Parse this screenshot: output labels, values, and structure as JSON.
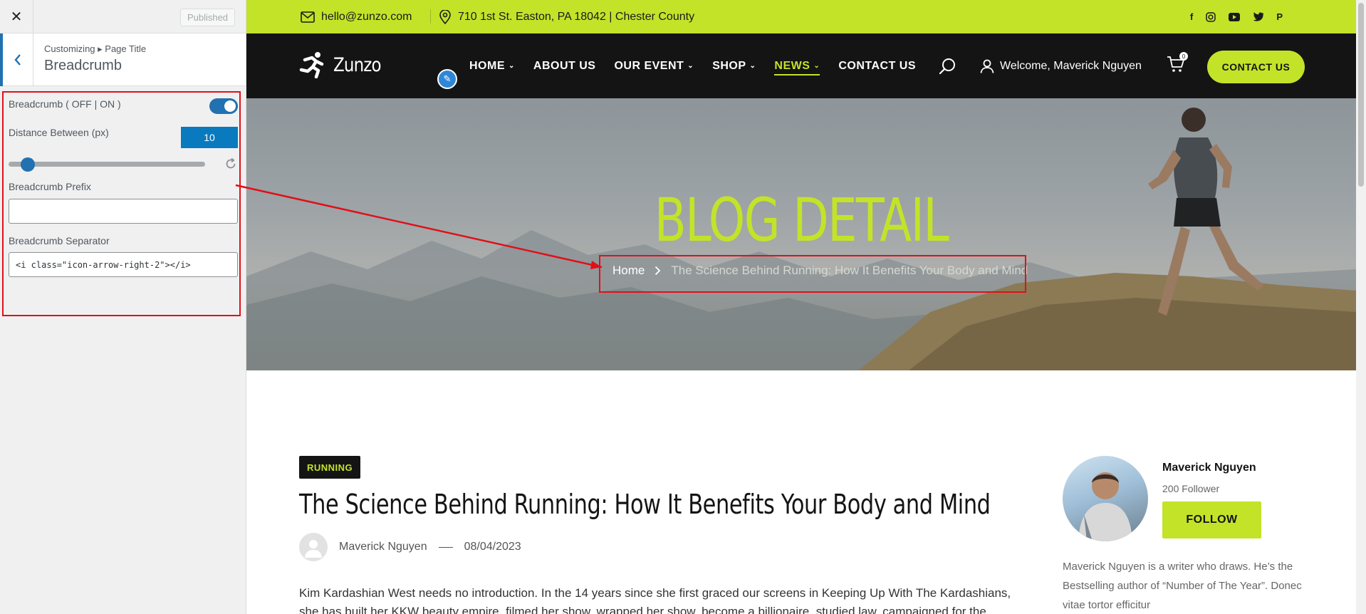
{
  "customizer": {
    "close_label": "✕",
    "publish_label": "Published",
    "breadcrumb_path": "Customizing ▸ Page Title",
    "section_title": "Breadcrumb",
    "toggle_label": "Breadcrumb ( OFF | ON )",
    "toggle_on": true,
    "distance_label": "Distance Between (px)",
    "distance_value": "10",
    "prefix_label": "Breadcrumb Prefix",
    "prefix_value": "",
    "separator_label": "Breadcrumb Separator",
    "separator_value": "<i class=\"icon-arrow-right-2\"></i>"
  },
  "topbar": {
    "email": "hello@zunzo.com",
    "address": "710 1st St. Easton, PA 18042 | Chester County",
    "socials": [
      "facebook-icon",
      "instagram-icon",
      "youtube-icon",
      "twitter-icon",
      "pinterest-icon"
    ]
  },
  "nav": {
    "logo_text": "Zunzo",
    "menu": [
      {
        "label": "HOME",
        "dropdown": true
      },
      {
        "label": "ABOUT US",
        "dropdown": false
      },
      {
        "label": "OUR EVENT",
        "dropdown": true
      },
      {
        "label": "SHOP",
        "dropdown": true
      },
      {
        "label": "NEWS",
        "dropdown": true,
        "active": true
      },
      {
        "label": "CONTACT US",
        "dropdown": false
      }
    ],
    "welcome": "Welcome, Maverick Nguyen",
    "cart_count": "0",
    "contact_button": "CONTACT US"
  },
  "hero": {
    "title": "BLOG DETAIL",
    "crumb_home": "Home",
    "crumb_current": "The Science Behind Running: How It Benefits Your Body and Mind"
  },
  "post": {
    "tag": "RUNNING",
    "title": "The Science Behind Running: How It Benefits Your Body and Mind",
    "author": "Maverick Nguyen",
    "date": "08/04/2023",
    "excerpt": "Kim Kardashian West needs no introduction. In the 14 years since she first graced our screens in Keeping Up With The Kardashians, she has built her KKW beauty empire, filmed her show, wrapped her show, become a billionaire, studied law, campaigned for the"
  },
  "author_box": {
    "name": "Maverick Nguyen",
    "followers": "200 Follower",
    "follow_button": "FOLLOW",
    "bio": "Maverick Nguyen is a writer who draws. He’s the Bestselling author of “Number of The Year”. Donec vitae tortor efficitur"
  },
  "colors": {
    "accent": "#c3e329",
    "navbar": "#141414",
    "wp_blue": "#2271b1",
    "annotation_red": "#e0101a"
  }
}
